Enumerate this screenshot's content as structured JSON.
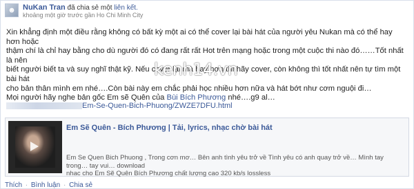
{
  "post": {
    "author": "NuKan Tran",
    "shared_text": "đã chia sẻ một",
    "shared_link": "liên kết.",
    "meta": "khoảng một giờ trước gần Ho Chi Minh City",
    "body_lines": [
      "Xin khẳng định một điều rằng không có bất kỳ một ai có thể cover lại bài hát của người yêu Nukan mà có thể hay hơn hoặc",
      "thậm chí là chỉ hay bằng cho dù người đó có đang rất rất Hot trên mạng hoặc trong một cuộc thi nào đó……Tốt nhất là nên",
      "biết người biết ta và suy nghĩ thật kỹ. Nếu cover lại mà hay hơn thì hãy cover, còn không thì tốt nhất nên tự tìm một bài hát",
      "cho bản thân mình em nhé….Còn bài này em chắc phải học nhiều hơn nữa và hát bớt như cơm nguội đi…"
    ],
    "last_line_before": "Mọi người hãy nghe bản gốc Em sẽ Quên của",
    "last_line_link": "Bùi Bích Phương",
    "last_line_after": "nhé….g9 al…",
    "url_visible": "Em-Se-Quen-Bich-Phuong/ZWZE7DFU.html",
    "watermark": "kenh14.vn"
  },
  "share": {
    "title": "Em Sẽ Quên - Bích Phương | Tải, lyrics, nhạc chờ bài hát",
    "desc_line1": "Em Se Quen Bich Phuong , Trong cơn mơ… Bên anh tình yêu trở về Tình yêu có anh quay trở về… Mình tay trong… tay vui… download",
    "desc_line2": "nhac cho Em Sẽ Quên Bích Phương chất lượng cao 320 kb/s lossless",
    "thumb_icon": "play-icon"
  },
  "actions": {
    "like": "Thích",
    "comment": "Bình luận",
    "share": "Chia sẻ",
    "separator": "·"
  },
  "colors": {
    "link": "#3b5998",
    "border": "#d8dfea",
    "share_bg": "#f6f7f9"
  }
}
